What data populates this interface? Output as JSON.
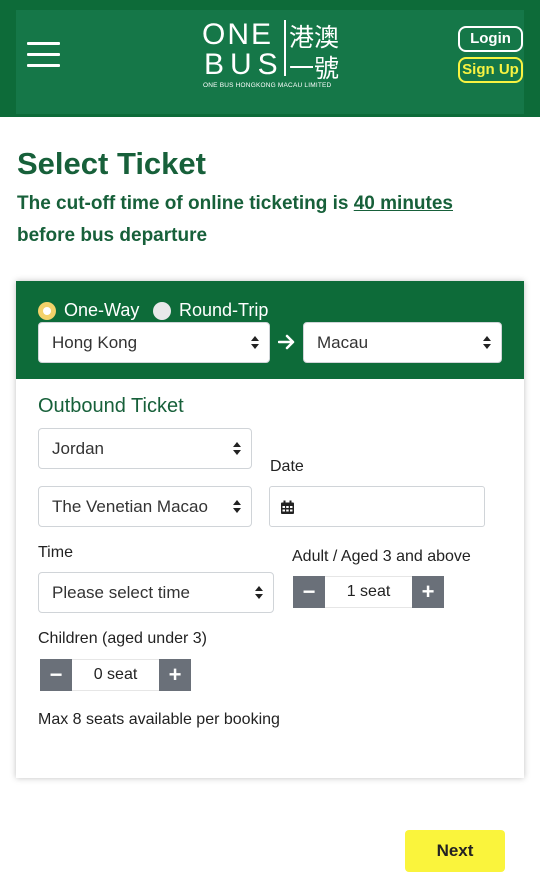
{
  "header": {
    "logo_en_line1": "ONE",
    "logo_en_line2": "BUS",
    "logo_zh_line1": "港澳",
    "logo_zh_line2": "一號",
    "logo_subtitle": "ONE BUS HONGKONG MACAU LIMITED",
    "login_label": "Login",
    "signup_label": "Sign Up"
  },
  "page": {
    "title": "Select Ticket",
    "notice_prefix": "The cut-off time of online ticketing is ",
    "notice_highlight": "40 minutes",
    "notice_suffix": "before bus departure"
  },
  "trip": {
    "one_way_label": "One-Way",
    "round_trip_label": "Round-Trip",
    "selected": "One-Way",
    "from": "Hong Kong",
    "to": "Macau"
  },
  "outbound": {
    "title": "Outbound Ticket",
    "pickup": "Jordan",
    "dropoff": "The Venetian Macao",
    "date_label": "Date",
    "date_value": "",
    "time_label": "Time",
    "time_placeholder": "Please select time",
    "adult_label": "Adult / Aged 3 and above",
    "adult_value": "1 seat",
    "children_label": "Children (aged under 3)",
    "children_value": "0 seat",
    "minus": "−",
    "plus": "+",
    "max_note": "Max 8 seats available per booking"
  },
  "footer": {
    "next_label": "Next"
  },
  "colors": {
    "brand_green": "#0d6b39",
    "title_green": "#17603a",
    "accent_yellow": "#faf43c"
  }
}
